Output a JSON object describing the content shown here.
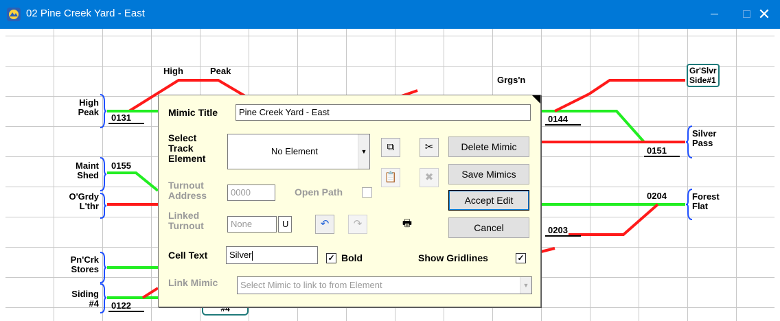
{
  "window": {
    "title": "02 Pine Creek Yard - East",
    "min_icon": "minimize-icon",
    "max_icon": "maximize-icon",
    "close_glyph": "✕"
  },
  "colors": {
    "titlebar": "#0078d7",
    "track_red": "#ff1a1a",
    "track_green": "#22ee22",
    "grid": "#c8c8c8",
    "dialog_bg": "#ffffe1"
  },
  "mimic_labels": {
    "high_peak_top_a": "High",
    "high_peak_top_b": "Peak",
    "grgsn": "Grgs'n",
    "gr_slvr_side_1": "Gr'Slvr",
    "gr_slvr_side_2": "Side#1",
    "high_peak_left_1": "High",
    "high_peak_left_2": "Peak",
    "maint_shed_1": "Maint",
    "maint_shed_2": "Shed",
    "ogrdy_1": "O'Grdy",
    "ogrdy_2": "L'thr",
    "pncrk_1": "Pn'Crk",
    "pncrk_2": "Stores",
    "siding4_1": "Siding",
    "siding4_2": "#4",
    "silver_pass_1": "Silver",
    "silver_pass_2": "Pass",
    "forest_flat_1": "Forest",
    "forest_flat_2": "Flat",
    "bottom_box": "#4"
  },
  "track_numbers": {
    "n0131": "0131",
    "n0155": "0155",
    "n0122": "0122",
    "n0144": "0144",
    "n0151": "0151",
    "n0204": "0204",
    "n0203": "0203"
  },
  "dialog": {
    "mimic_title_label": "Mimic Title",
    "mimic_title_value": "Pine Creek Yard - East",
    "select_label_1": "Select",
    "select_label_2": "Track",
    "select_label_3": "Element",
    "element_value": "No Element",
    "turnout_label_1": "Turnout",
    "turnout_label_2": "Address",
    "turnout_value": "0000",
    "open_path_label": "Open Path",
    "linked_label_1": "Linked",
    "linked_label_2": "Turnout",
    "linked_value": "None",
    "linked_suffix": "U",
    "cell_text_label": "Cell Text",
    "cell_text_value": "Silver",
    "bold_label": "Bold",
    "bold_checked": "✓",
    "gridlines_label": "Show Gridlines",
    "gridlines_checked": "✓",
    "link_mimic_label": "Link Mimic",
    "link_mimic_placeholder": "Select Mimic to link to from Element",
    "delete_mimic": "Delete Mimic",
    "save_mimics": "Save Mimics",
    "accept_edit": "Accept Edit",
    "cancel": "Cancel",
    "icons": {
      "copy": "copy-icon",
      "cut": "cut-icon",
      "paste": "paste-icon",
      "delete": "delete-element-icon",
      "undo": "undo-icon",
      "redo": "redo-icon",
      "print": "print-icon"
    }
  }
}
